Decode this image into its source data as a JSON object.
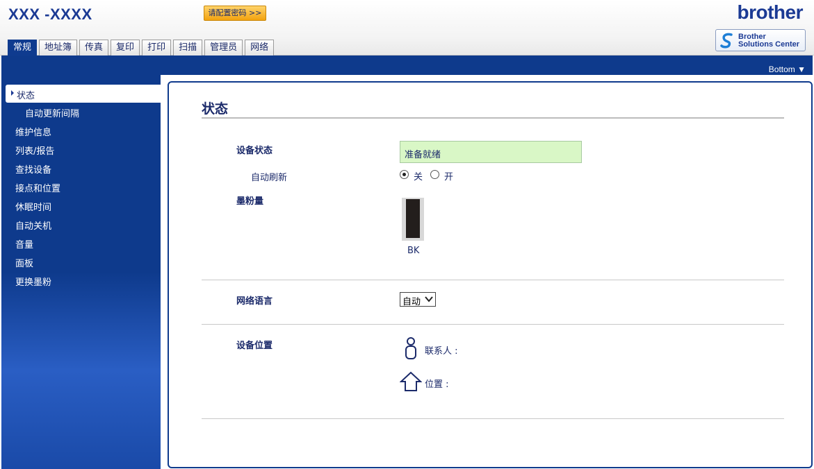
{
  "header": {
    "model": "XXX -XXXX",
    "config_password_button": "请配置密码 >>",
    "brand": "brother",
    "solutions_center": {
      "line1": "Brother",
      "line2": "Solutions Center"
    }
  },
  "tabs": [
    {
      "label": "常规",
      "active": true
    },
    {
      "label": "地址簿"
    },
    {
      "label": "传真"
    },
    {
      "label": "复印"
    },
    {
      "label": "打印"
    },
    {
      "label": "扫描"
    },
    {
      "label": "管理员"
    },
    {
      "label": "网络"
    }
  ],
  "bottom_link": "Bottom ▼",
  "sidebar": {
    "items": [
      {
        "label": "状态",
        "active": true
      },
      {
        "label": "自动更新间隔",
        "sub": true
      },
      {
        "label": "维护信息"
      },
      {
        "label": "列表/报告"
      },
      {
        "label": "查找设备"
      },
      {
        "label": "接点和位置"
      },
      {
        "label": "休眠时间"
      },
      {
        "label": "自动关机"
      },
      {
        "label": "音量"
      },
      {
        "label": "面板"
      },
      {
        "label": "更换墨粉"
      }
    ]
  },
  "main": {
    "title": "状态",
    "device_status": {
      "label": "设备状态",
      "value": "准备就绪"
    },
    "auto_refresh": {
      "label": "自动刷新",
      "option_off": "关",
      "option_on": "开",
      "selected": "关"
    },
    "toner": {
      "label": "墨粉量",
      "color_label": "BK",
      "level": 1.0
    },
    "web_language": {
      "label": "网络语言",
      "value": "自动"
    },
    "device_location": {
      "label": "设备位置",
      "contact_label": "联系人 :",
      "location_label": "位置 :"
    }
  },
  "colors": {
    "accent": "#0e3a8c",
    "status_bg": "#d9f7c6",
    "button_orange": "#f2a20f"
  }
}
